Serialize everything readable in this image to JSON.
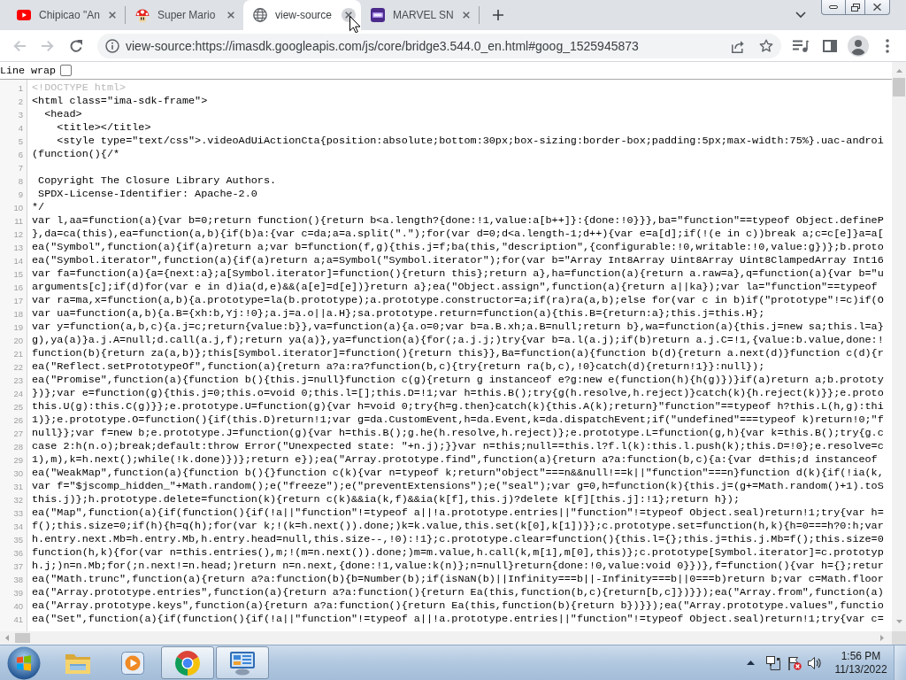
{
  "tabs": [
    {
      "kind": "video",
      "title": "Chipicao \"An",
      "selected": false,
      "close_hovered": false
    },
    {
      "kind": "mushroom",
      "title": "Super Mario",
      "selected": false,
      "close_hovered": false
    },
    {
      "kind": "globe",
      "title": "view-source",
      "selected": true,
      "close_hovered": true
    },
    {
      "kind": "tile",
      "title": "MARVEL SN",
      "selected": false,
      "close_hovered": false
    }
  ],
  "toolbar": {
    "nav": [
      {
        "kind": "back",
        "disabled": true
      },
      {
        "kind": "forward",
        "disabled": true
      },
      {
        "kind": "reload",
        "disabled": false
      }
    ],
    "url": "view-source:https://imasdk.googleapis.com/js/core/bridge3.544.0_en.html#goog_1525945873"
  },
  "line_wrap": {
    "label": "Line wrap",
    "checked": false
  },
  "source": {
    "lines": [
      {
        "number": "1",
        "kind": "doctype",
        "text": "<!DOCTYPE html>"
      },
      {
        "number": "2",
        "kind": "code",
        "text": "<html class=\"ima-sdk-frame\">"
      },
      {
        "number": "3",
        "kind": "code",
        "text": "  <head>"
      },
      {
        "number": "4",
        "kind": "code",
        "text": "    <title></title>"
      },
      {
        "number": "5",
        "kind": "code",
        "text": "    <style type=\"text/css\">.videoAdUiActionCta{position:absolute;bottom:30px;box-sizing:border-box;padding:5px;max-width:75%}.uac-androi"
      },
      {
        "number": "6",
        "kind": "code",
        "text": "(function(){/*"
      },
      {
        "number": "7",
        "kind": "code"
      },
      {
        "number": "8",
        "kind": "code",
        "text": " Copyright The Closure Library Authors."
      },
      {
        "number": "9",
        "kind": "code",
        "text": " SPDX-License-Identifier: Apache-2.0"
      },
      {
        "number": "10",
        "kind": "code",
        "text": "*/"
      },
      {
        "number": "11",
        "kind": "code",
        "text": "var l,aa=function(a){var b=0;return function(){return b<a.length?{done:!1,value:a[b++]}:{done:!0}}},ba=\"function\"==typeof Object.defineP"
      },
      {
        "number": "12",
        "kind": "code",
        "text": "},da=ca(this),ea=function(a,b){if(b)a:{var c=da;a=a.split(\".\");for(var d=0;d<a.length-1;d++){var e=a[d];if(!(e in c))break a;c=c[e]}a=a["
      },
      {
        "number": "13",
        "kind": "code",
        "text": "ea(\"Symbol\",function(a){if(a)return a;var b=function(f,g){this.j=f;ba(this,\"description\",{configurable:!0,writable:!0,value:g})};b.proto"
      },
      {
        "number": "14",
        "kind": "code",
        "text": "ea(\"Symbol.iterator\",function(a){if(a)return a;a=Symbol(\"Symbol.iterator\");for(var b=\"Array Int8Array Uint8Array Uint8ClampedArray Int16"
      },
      {
        "number": "15",
        "kind": "code",
        "text": "var fa=function(a){a={next:a};a[Symbol.iterator]=function(){return this};return a},ha=function(a){return a.raw=a},q=function(a){var b=\"u"
      },
      {
        "number": "16",
        "kind": "code",
        "text": "arguments[c];if(d)for(var e in d)ia(d,e)&&(a[e]=d[e])}return a};ea(\"Object.assign\",function(a){return a||ka});var la=\"function\"==typeof"
      },
      {
        "number": "17",
        "kind": "code",
        "text": "var ra=ma,x=function(a,b){a.prototype=la(b.prototype);a.prototype.constructor=a;if(ra)ra(a,b);else for(var c in b)if(\"prototype\"!=c)if(O"
      },
      {
        "number": "18",
        "kind": "code",
        "text": "var ua=function(a,b){a.B={xh:b,Yj:!0};a.j=a.o||a.H};sa.prototype.return=function(a){this.B={return:a};this.j=this.H};"
      },
      {
        "number": "19",
        "kind": "code",
        "text": "var y=function(a,b,c){a.j=c;return{value:b}},va=function(a){a.o=0;var b=a.B.xh;a.B=null;return b},wa=function(a){this.j=new sa;this.l=a}"
      },
      {
        "number": "20",
        "kind": "code",
        "text": "g),ya(a)}a.j.A=null;d.call(a.j,f);return ya(a)},ya=function(a){for(;a.j.j;)try{var b=a.l(a.j);if(b)return a.j.C=!1,{value:b.value,done:!"
      },
      {
        "number": "21",
        "kind": "code",
        "text": "function(b){return za(a,b)};this[Symbol.iterator]=function(){return this}},Ba=function(a){function b(d){return a.next(d)}function c(d){r"
      },
      {
        "number": "22",
        "kind": "code",
        "text": "ea(\"Reflect.setPrototypeOf\",function(a){return a?a:ra?function(b,c){try{return ra(b,c),!0}catch(d){return!1}}:null});"
      },
      {
        "number": "23",
        "kind": "code",
        "text": "ea(\"Promise\",function(a){function b(){this.j=null}function c(g){return g instanceof e?g:new e(function(h){h(g)})}if(a)return a;b.prototy"
      },
      {
        "number": "24",
        "kind": "code",
        "text": "})};var e=function(g){this.j=0;this.o=void 0;this.l=[];this.D=!1;var h=this.B();try{g(h.resolve,h.reject)}catch(k){h.reject(k)}};e.proto"
      },
      {
        "number": "25",
        "kind": "code",
        "text": "this.U(g):this.C(g)}};e.prototype.U=function(g){var h=void 0;try{h=g.then}catch(k){this.A(k);return}\"function\"==typeof h?this.L(h,g):thi"
      },
      {
        "number": "26",
        "kind": "code",
        "text": "1)};e.prototype.O=function(){if(this.D)return!1;var g=da.CustomEvent,h=da.Event,k=da.dispatchEvent;if(\"undefined\"===typeof k)return!0;\"f"
      },
      {
        "number": "27",
        "kind": "code",
        "text": "null}};var f=new b;e.prototype.J=function(g){var h=this.B();g.he(h.resolve,h.reject)};e.prototype.L=function(g,h){var k=this.B();try{g.c"
      },
      {
        "number": "28",
        "kind": "code",
        "text": "case 2:h(n.o);break;default:throw Error(\"Unexpected state: \"+n.j);}}var n=this;null==this.l?f.l(k):this.l.push(k);this.D=!0};e.resolve=c"
      },
      {
        "number": "29",
        "kind": "code",
        "text": "1),m),k=h.next();while(!k.done)})};return e});ea(\"Array.prototype.find\",function(a){return a?a:function(b,c){a:{var d=this;d instanceof"
      },
      {
        "number": "30",
        "kind": "code",
        "text": "ea(\"WeakMap\",function(a){function b(){}function c(k){var n=typeof k;return\"object\"===n&&null!==k||\"function\"===n}function d(k){if(!ia(k,"
      },
      {
        "number": "31",
        "kind": "code",
        "text": "var f=\"$jscomp_hidden_\"+Math.random();e(\"freeze\");e(\"preventExtensions\");e(\"seal\");var g=0,h=function(k){this.j=(g+=Math.random()+1).toS"
      },
      {
        "number": "32",
        "kind": "code",
        "text": "this.j)};h.prototype.delete=function(k){return c(k)&&ia(k,f)&&ia(k[f],this.j)?delete k[f][this.j]:!1};return h});"
      },
      {
        "number": "33",
        "kind": "code",
        "text": "ea(\"Map\",function(a){if(function(){if(!a||\"function\"!=typeof a||!a.prototype.entries||\"function\"!=typeof Object.seal)return!1;try{var h="
      },
      {
        "number": "34",
        "kind": "code",
        "text": "f();this.size=0;if(h){h=q(h);for(var k;!(k=h.next()).done;)k=k.value,this.set(k[0],k[1])}};c.prototype.set=function(h,k){h=0===h?0:h;var"
      },
      {
        "number": "35",
        "kind": "code",
        "text": "h.entry.next.Mb=h.entry.Mb,h.entry.head=null,this.size--,!0):!1};c.prototype.clear=function(){this.l={};this.j=this.j.Mb=f();this.size=0"
      },
      {
        "number": "36",
        "kind": "code",
        "text": "function(h,k){for(var n=this.entries(),m;!(m=n.next()).done;)m=m.value,h.call(k,m[1],m[0],this)};c.prototype[Symbol.iterator]=c.prototyp"
      },
      {
        "number": "37",
        "kind": "code",
        "text": "h.j;)n=n.Mb;for(;n.next!=n.head;)return n=n.next,{done:!1,value:k(n)};n=null}return{done:!0,value:void 0}})},f=function(){var h={};retur"
      },
      {
        "number": "38",
        "kind": "code",
        "text": "ea(\"Math.trunc\",function(a){return a?a:function(b){b=Number(b);if(isNaN(b)||Infinity===b||-Infinity===b||0===b)return b;var c=Math.floor"
      },
      {
        "number": "39",
        "kind": "code",
        "text": "ea(\"Array.prototype.entries\",function(a){return a?a:function(){return Ea(this,function(b,c){return[b,c]})}});ea(\"Array.from\",function(a)"
      },
      {
        "number": "40",
        "kind": "code",
        "text": "ea(\"Array.prototype.keys\",function(a){return a?a:function(){return Ea(this,function(b){return b})}});ea(\"Array.prototype.values\",functio"
      },
      {
        "number": "41",
        "kind": "code",
        "text": "ea(\"Set\",function(a){if(function(){if(!a||\"function\"!=typeof a||!a.prototype.entries||\"function\"!=typeof Object.seal)return!1;try{var c="
      }
    ]
  },
  "taskbar": {
    "apps": [
      {
        "kind": "folder",
        "running": false
      },
      {
        "kind": "media",
        "running": false
      },
      {
        "kind": "browser",
        "running": true
      },
      {
        "kind": "panel",
        "running": true
      }
    ],
    "clock": {
      "time": "1:56 PM",
      "date": "11/13/2022"
    }
  }
}
